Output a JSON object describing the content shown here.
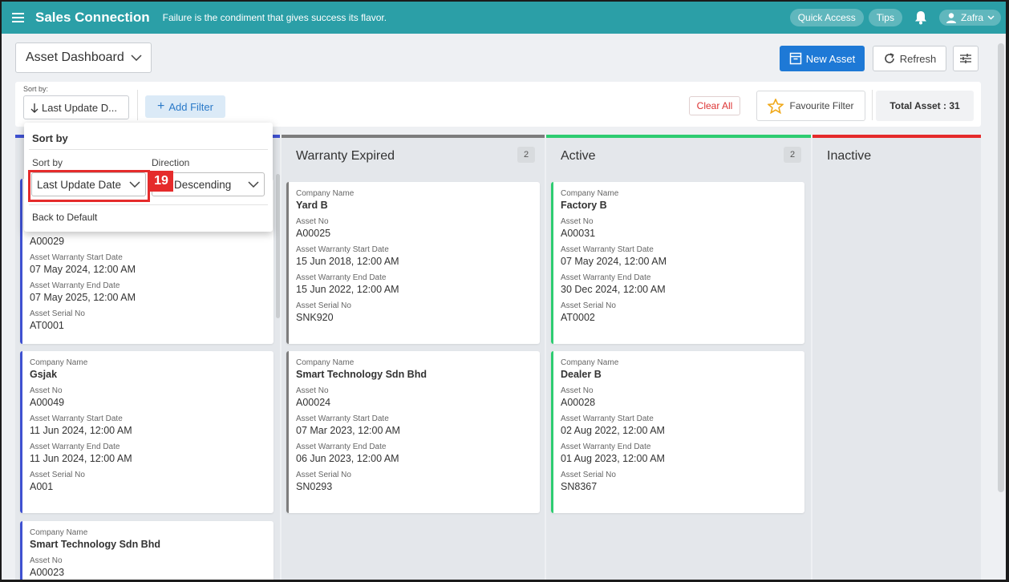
{
  "topbar": {
    "brand": "Sales Connection",
    "tagline": "Failure is the condiment that gives success its flavor.",
    "quick_access": "Quick Access",
    "tips": "Tips",
    "user": "Zafra",
    "icons": [
      "menu-icon",
      "bell-icon",
      "user-icon",
      "chevron-down-icon"
    ]
  },
  "header": {
    "dashboard": "Asset Dashboard",
    "new_asset": "New Asset",
    "refresh": "Refresh"
  },
  "filterbar": {
    "sort_label": "Sort by:",
    "sort_value": "Last Update D...",
    "add_filter": "Add Filter",
    "clear_all": "Clear All",
    "favourite": "Favourite Filter",
    "total": "Total Asset : 31"
  },
  "sort_popup": {
    "title": "Sort by",
    "sort_label": "Sort by",
    "direction_label": "Direction",
    "sort_value": "Last Update Date",
    "direction_value": "Descending",
    "back": "Back to Default",
    "annotation": "19"
  },
  "labels": {
    "company": "Company Name",
    "asset_no": "Asset No",
    "start": "Asset Warranty Start Date",
    "end": "Asset Warranty End Date",
    "serial": "Asset Serial No"
  },
  "columns": [
    {
      "title": "",
      "count": "",
      "color": "#3f51d1",
      "cards": [
        {
          "asset_no": "A00029",
          "start": "07 May 2024, 12:00 AM",
          "end": "07 May 2025, 12:00 AM",
          "serial": "AT0001"
        },
        {
          "company": "Gsjak",
          "asset_no": "A00049",
          "start": "11 Jun 2024, 12:00 AM",
          "end": "11 Jun 2024, 12:00 AM",
          "serial": "A001"
        },
        {
          "company": "Smart Technology Sdn Bhd",
          "asset_no": "A00023"
        }
      ]
    },
    {
      "title": "Warranty Expired",
      "count": "2",
      "color": "#7d7d7d",
      "cards": [
        {
          "company": "Yard B",
          "asset_no": "A00025",
          "start": "15 Jun 2018, 12:00 AM",
          "end": "15 Jun 2022, 12:00 AM",
          "serial": "SNK920"
        },
        {
          "company": "Smart Technology Sdn Bhd",
          "asset_no": "A00024",
          "start": "07 Mar 2023, 12:00 AM",
          "end": "06 Jun 2023, 12:00 AM",
          "serial": "SN0293"
        }
      ]
    },
    {
      "title": "Active",
      "count": "2",
      "color": "#2ecc71",
      "cards": [
        {
          "company": "Factory B",
          "asset_no": "A00031",
          "start": "07 May 2024, 12:00 AM",
          "end": "30 Dec 2024, 12:00 AM",
          "serial": "AT0002"
        },
        {
          "company": "Dealer B",
          "asset_no": "A00028",
          "start": "02 Aug 2022, 12:00 AM",
          "end": "01 Aug 2023, 12:00 AM",
          "serial": "SN8367"
        }
      ]
    },
    {
      "title": "Inactive",
      "count": "",
      "color": "#e52b2b",
      "cards": []
    }
  ]
}
